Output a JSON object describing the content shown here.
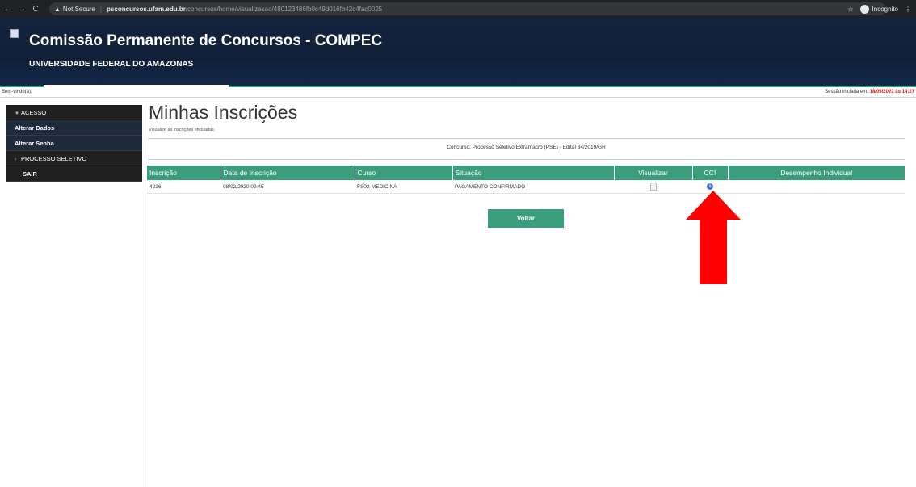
{
  "browser": {
    "warning": "Not Secure",
    "url_host": "psconcursos.ufam.edu.br",
    "url_path": "/concursos/home/visualizacao/480123486fb0c49d016fb42c4fac0025",
    "incognito_label": "Incognito",
    "icons": [
      "back-arrow-icon",
      "forward-arrow-icon",
      "reload-icon",
      "warning-icon",
      "star-icon",
      "incognito-icon",
      "kebab-menu-icon"
    ]
  },
  "header": {
    "title": "Comissão Permanente de Concursos - COMPEC",
    "subtitle": "UNIVERSIDADE FEDERAL DO AMAZONAS"
  },
  "welcome": {
    "text": "Bem-vindo(a),",
    "session_label": "Sessão iniciada em:",
    "session_value": "18/05/2021 às 14:27"
  },
  "sidebar": {
    "items": [
      {
        "label": "ACESSO",
        "type": "section",
        "caret": "▼"
      },
      {
        "label": "Alterar Dados",
        "type": "sub"
      },
      {
        "label": "Alterar Senha",
        "type": "sub"
      },
      {
        "label": "PROCESSO SELETIVO",
        "type": "section",
        "caret": "›"
      },
      {
        "label": "SAIR",
        "type": "section",
        "caret": ""
      }
    ]
  },
  "main": {
    "title": "Minhas Inscrições",
    "subtitle": "Visualize as inscrições efetuadas.",
    "contest": "Concurso: Processo Seletivo Extramacro (PSE) - Edital 84/2019/GR",
    "columns": [
      "Inscrição",
      "Data de Inscrição",
      "Curso",
      "Situação",
      "Visualizar",
      "CCI",
      "Desempenho Individual"
    ],
    "rows": [
      {
        "inscricao": "4226",
        "data": "08/02/2020 09:45",
        "curso": "FS02-MEDICINA",
        "situacao": "PAGAMENTO CONFIRMADO",
        "visualizar_icon": "document-icon",
        "cci_icon": "info-icon",
        "desempenho": ""
      }
    ],
    "back_button": "Voltar"
  },
  "colors": {
    "header_bg": "#14243f",
    "accent_green": "#3a9e7c",
    "sidebar_bg": "#202020",
    "session_red": "#e11111",
    "annotation_arrow": "#ff0000"
  }
}
